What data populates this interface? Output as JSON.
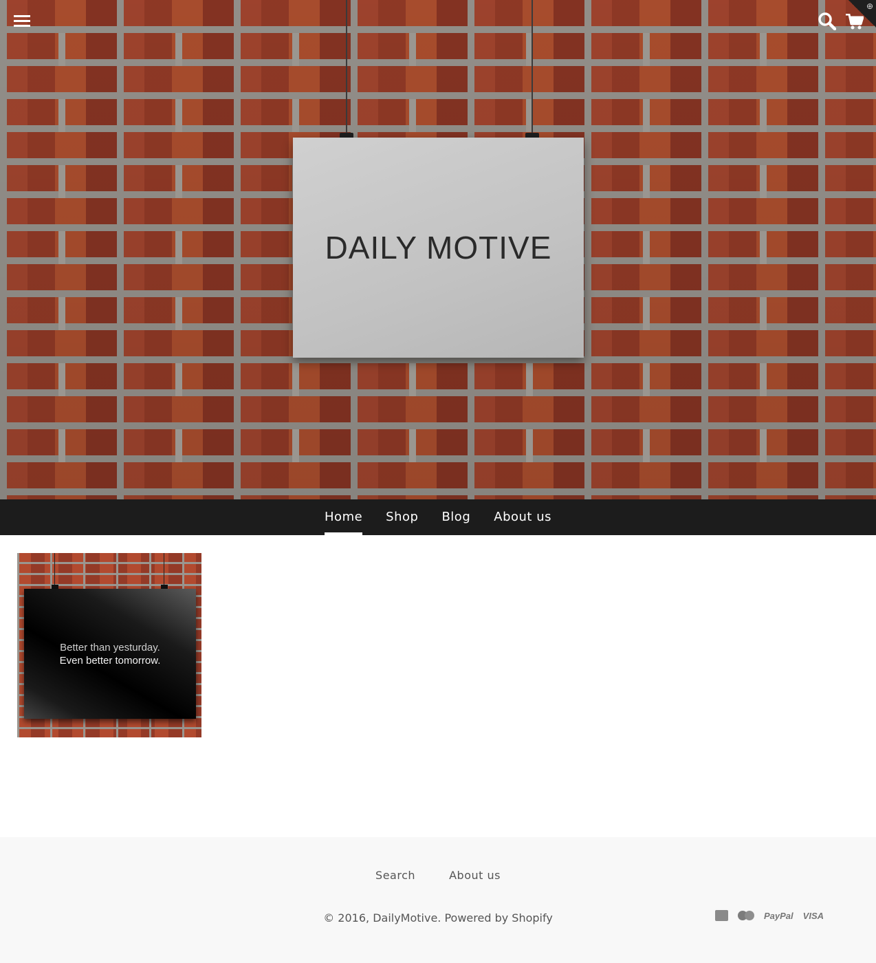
{
  "header": {
    "menu_icon": "hamburger-icon",
    "search_icon": "search-icon",
    "cart_icon": "cart-icon",
    "badge_icon": "plus-circle-icon",
    "badge_glyph": "⊕"
  },
  "hero": {
    "poster_text": "DAILY MOTIVE"
  },
  "nav": {
    "items": [
      {
        "label": "Home",
        "active": true
      },
      {
        "label": "Shop",
        "active": false
      },
      {
        "label": "Blog",
        "active": false
      },
      {
        "label": "About us",
        "active": false
      }
    ]
  },
  "products": [
    {
      "line1": "Better than yesturday.",
      "line2": "Even better tomorrow."
    }
  ],
  "footer": {
    "links": [
      "Search",
      "About us"
    ],
    "copyright_prefix": "© 2016, ",
    "store_name": "DailyMotive",
    "separator": ". ",
    "powered_by": "Powered by Shopify",
    "payment_icons": [
      "american-express-icon",
      "mastercard-icon",
      "paypal-icon",
      "visa-icon"
    ],
    "paypal_label": "PayPal",
    "visa_label": "VISA"
  }
}
